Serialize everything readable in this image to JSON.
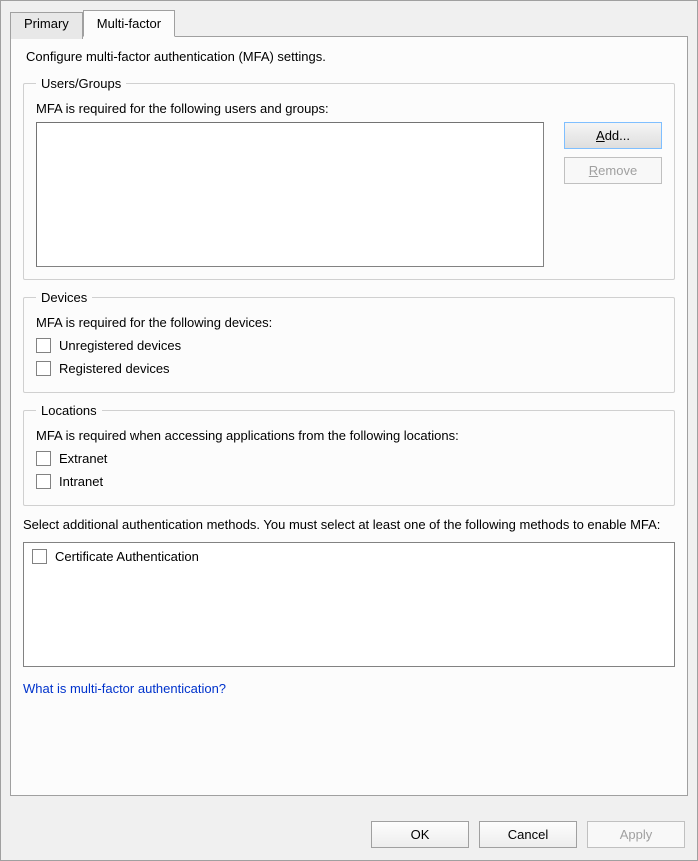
{
  "tabs": {
    "primary": "Primary",
    "multifactor": "Multi-factor"
  },
  "description": "Configure multi-factor authentication (MFA) settings.",
  "usersGroups": {
    "legend": "Users/Groups",
    "label": "MFA is required for the following users and groups:",
    "addLabelPre": "",
    "addLabelU": "A",
    "addLabelPost": "dd...",
    "removeLabelPre": "",
    "removeLabelU": "R",
    "removeLabelPost": "emove"
  },
  "devices": {
    "legend": "Devices",
    "label": "MFA is required for the following devices:",
    "unregistered": "Unregistered devices",
    "registered": "Registered devices"
  },
  "locations": {
    "legend": "Locations",
    "label": "MFA is required when accessing applications from the following locations:",
    "extranet": "Extranet",
    "intranet": "Intranet"
  },
  "methods": {
    "label": "Select additional authentication methods. You must select at least one of the following methods to enable MFA:",
    "certificate": "Certificate Authentication"
  },
  "link": "What is multi-factor authentication?",
  "actions": {
    "ok": "OK",
    "cancel": "Cancel",
    "apply": "Apply"
  }
}
